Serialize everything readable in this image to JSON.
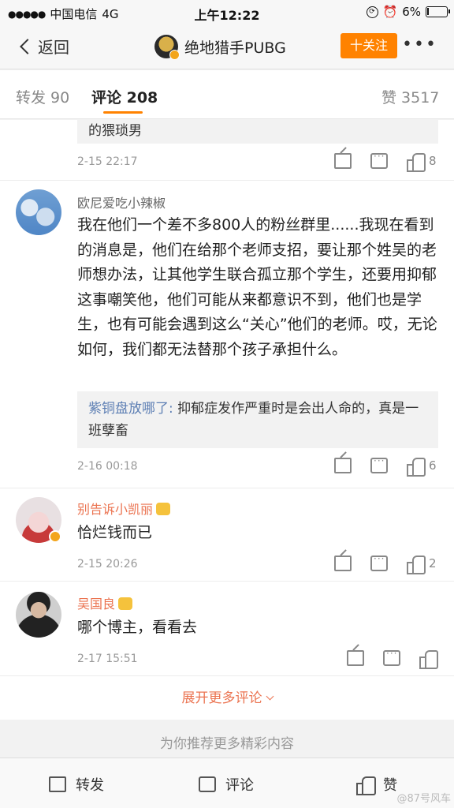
{
  "status_bar": {
    "carrier": "中国电信",
    "network": "4G",
    "time": "上午12:22",
    "battery": "6%",
    "battery_level": 0.06
  },
  "nav": {
    "back_label": "返回",
    "title": "绝地猎手PUBG",
    "follow_label": "十关注",
    "more_label": "•••"
  },
  "tabs": {
    "repost": "转发 90",
    "comments": "评论 208",
    "likes": "赞 3517"
  },
  "comments": [
    {
      "reply_partial": "的猥琐男",
      "date": "2-15 22:17",
      "likes": "8"
    },
    {
      "username": "欧尼爱吃小辣椒",
      "text": "我在他们一个差不多800人的粉丝群里......我现在看到的消息是，他们在给那个老师支招，要让那个姓吴的老师想办法，让其他学生联合孤立那个学生，还要用抑郁这事嘲笑他，他们可能从来都意识不到，他们也是学生，也有可能会遇到这么“关心”他们的老师。哎，无论如何，我们都无法替那个孩子承担什么。",
      "reply_user": "紫铜盘放哪了:",
      "reply_text": "抑郁症发作严重时是会出人命的，真是一班孽畜",
      "date": "2-16 00:18",
      "likes": "6"
    },
    {
      "username": "别告诉小凯丽",
      "text": "恰烂钱而已",
      "date": "2-15 20:26",
      "likes": "2"
    },
    {
      "username": "吴国良",
      "text": "哪个博主，看看去",
      "date": "2-17 15:51",
      "likes": ""
    }
  ],
  "expand_label": "展开更多评论",
  "recommend_label": "为你推荐更多精彩内容",
  "bottom_bar": {
    "repost": "转发",
    "comment": "评论",
    "like": "赞"
  },
  "watermark": "@87号风车"
}
